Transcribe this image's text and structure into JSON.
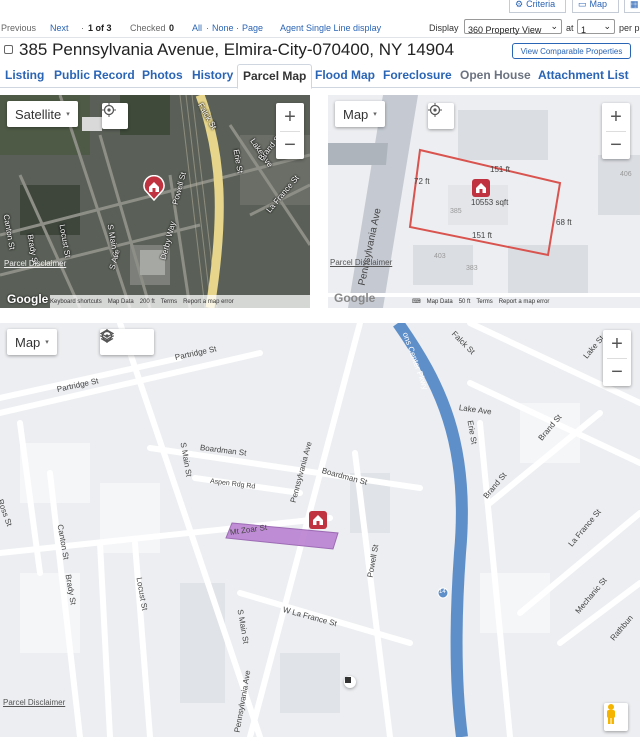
{
  "toolbar": {
    "criteria_label": "Criteria",
    "map_label": "Map"
  },
  "nav": {
    "previous": "Previous",
    "next": "Next",
    "position": "1 of 3",
    "checked_label": "Checked",
    "checked_count": "0",
    "all": "All",
    "none": "None",
    "page": "Page",
    "display_option": "Agent Single Line display",
    "display_label": "Display",
    "view_select": "360 Property View",
    "at_label": "at",
    "per_page_value": "1",
    "per_label": "per p"
  },
  "listing": {
    "address": "385 Pennsylvania Avenue, Elmira-City-070400, NY 14904",
    "view_comparable": "View Comparable Properties"
  },
  "tabs": [
    {
      "label": "Listing"
    },
    {
      "label": "Public Record"
    },
    {
      "label": "Photos"
    },
    {
      "label": "History"
    },
    {
      "label": "Parcel Map"
    },
    {
      "label": "Flood Map"
    },
    {
      "label": "Foreclosure"
    },
    {
      "label": "Open House"
    },
    {
      "label": "Attachment List"
    }
  ],
  "satellite_map": {
    "type_button": "Satellite",
    "disclaimer": "Parcel Disclaimer",
    "footer": [
      "Keyboard shortcuts",
      "Map Data",
      "200 ft",
      "Terms",
      "Report a map error"
    ],
    "labels": [
      "Falck St",
      "Lake Ave",
      "Erie St",
      "Brand St",
      "La France St",
      "Canton St",
      "Brady St",
      "Locust St",
      "S Main St",
      "Powell St",
      "Derby Way",
      "S Ave"
    ],
    "road_color": "#e6d58a"
  },
  "parcel_map": {
    "type_button": "Map",
    "disclaimer": "Parcel Disclaimer",
    "street": "Pennsylvania Ave",
    "area": "10553 sqft",
    "dimensions": [
      "151 ft",
      "72 ft",
      "68 ft",
      "151 ft"
    ],
    "numbers": [
      "383",
      "385",
      "403",
      "406"
    ],
    "footer": [
      "Map Data",
      "50 ft",
      "Terms",
      "Report a map error"
    ],
    "boundary_color": "#d9534f"
  },
  "street_map": {
    "type_button": "Map",
    "disclaimer": "Parcel Disclaimer",
    "labels": [
      "Partridge St",
      "Partridge St",
      "Boardman St",
      "Boardman St",
      "Aspen Rdg Rd",
      "Mt Zoar St",
      "W La France St",
      "Pennsylvania Ave",
      "Pennsylvania Ave",
      "S Main St",
      "S Main St",
      "Canton St",
      "Brady St",
      "Locust St",
      "Powell St",
      "Lake Ave",
      "Erie St",
      "Brand St",
      "Brand St",
      "La France St",
      "Mechanic St",
      "Rathbun",
      "Falck St",
      "Lake St",
      "Ross St",
      "ons Center Pkwy",
      "14"
    ],
    "highway_color": "#5f8fc9",
    "parcel_color": "#b77bd0"
  },
  "colors": {
    "link": "#2a64b5",
    "pin": "#c0323f"
  },
  "icons": [
    "criteria-icon",
    "map-icon",
    "grid-icon",
    "locate-icon",
    "layers-icon",
    "home-pin-icon",
    "pegman-icon"
  ]
}
